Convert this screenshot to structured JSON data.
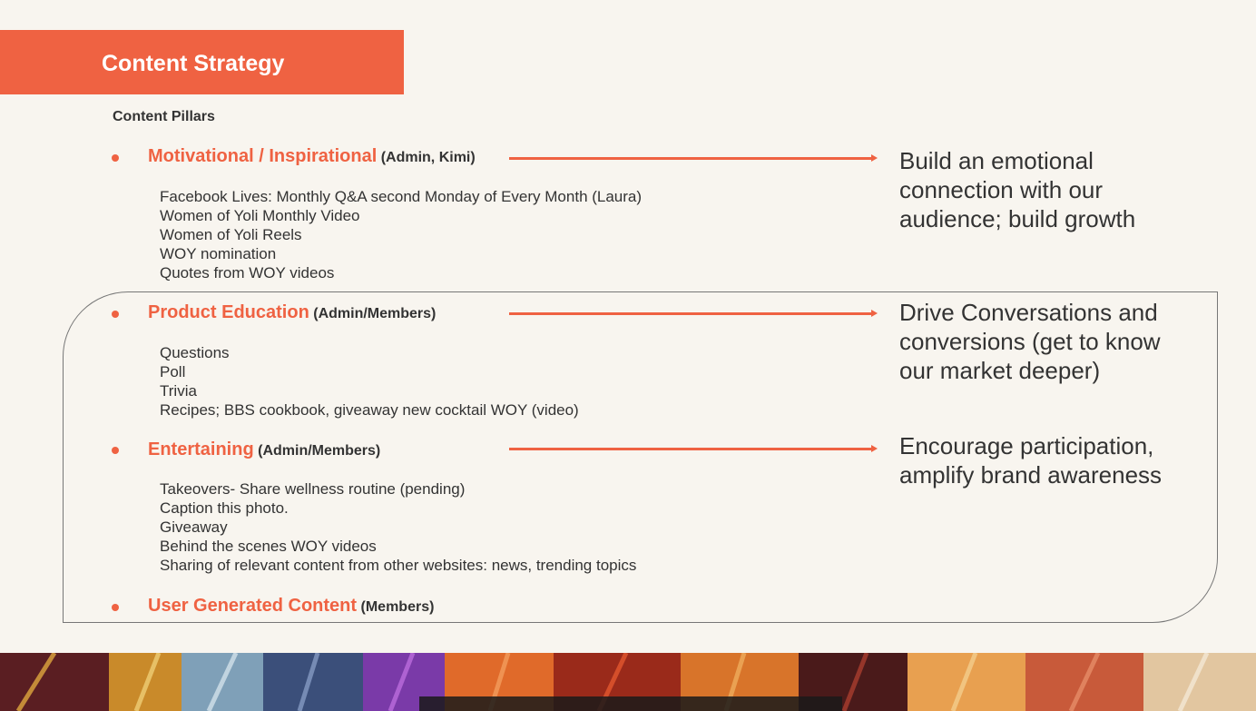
{
  "header": {
    "title": "Content Strategy"
  },
  "section_label": "Content Pillars",
  "pillars": [
    {
      "name": "Motivational / Inspirational",
      "owners": "(Admin, Kimi)",
      "items": [
        "Facebook Lives: Monthly Q&A second Monday of Every Month (Laura)",
        "Women of Yoli Monthly Video",
        "Women of Yoli Reels",
        "WOY nomination",
        "Quotes from WOY videos"
      ],
      "goal": "Build an emotional connection with our audience; build growth"
    },
    {
      "name": "Product Education",
      "owners": "(Admin/Members)",
      "items": [
        "Questions",
        "Poll",
        "Trivia",
        "Recipes; BBS cookbook, giveaway new cocktail WOY (video)"
      ],
      "goal": "Drive Conversations and conversions (get to know our market deeper)"
    },
    {
      "name": "Entertaining",
      "owners": "(Admin/Members)",
      "items": [
        "Takeovers- Share wellness routine (pending)",
        "Caption this photo.",
        "Giveaway",
        "Behind the scenes WOY videos",
        "Sharing of relevant content from other websites: news, trending topics"
      ],
      "goal": "Encourage participation, amplify brand awareness"
    },
    {
      "name": "User Generated Content",
      "owners": "(Members)"
    }
  ],
  "colors": {
    "accent": "#ef6242",
    "background": "#f8f5ef",
    "text": "#333333"
  }
}
